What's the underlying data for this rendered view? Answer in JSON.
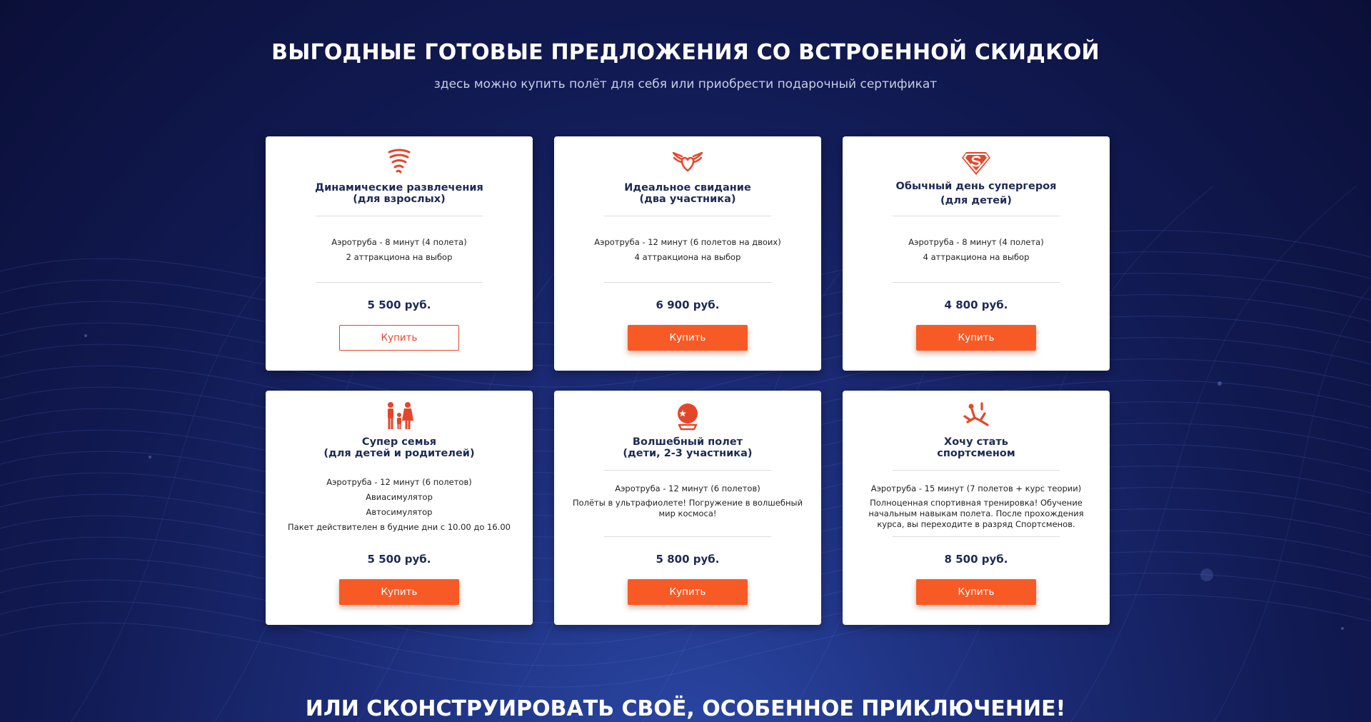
{
  "colors": {
    "accent": "#f85a25",
    "card_title": "#1e2a55",
    "background_dark": "#0b0f38",
    "background_light": "#2c4aa8"
  },
  "header": {
    "title": "ВЫГОДНЫЕ ГОТОВЫЕ ПРЕДЛОЖЕНИЯ СО ВСТРОЕННОЙ СКИДКОЙ",
    "subtitle": "здесь можно купить полёт для себя или приобрести подарочный сертификат"
  },
  "cards": [
    {
      "icon": "tornado-icon",
      "title": "Динамические развлечения\n(для взрослых)",
      "features": [
        "Аэротруба - 8 минут (4 полета)",
        "2 аттракциона на выбор"
      ],
      "price": "5 500 руб.",
      "button_label": "Купить",
      "button_style": "outline"
    },
    {
      "icon": "winged-heart-icon",
      "title": "Идеальное свидание\n(два участника)",
      "features": [
        "Аэротруба - 12 минут (6 полетов на двоих)",
        "4 аттракциона на выбор"
      ],
      "price": "6 900 руб.",
      "button_label": "Купить",
      "button_style": "filled"
    },
    {
      "icon": "superhero-shield-icon",
      "title": "Обычный день супергероя\n(для детей)",
      "features": [
        "Аэротруба - 8 минут (4 полета)",
        "4 аттракциона на выбор"
      ],
      "price": "4 800 руб.",
      "button_label": "Купить",
      "button_style": "filled"
    },
    {
      "icon": "family-icon",
      "title": "Супер семья\n(для детей и родителей)",
      "features": [
        "Аэротруба - 12 минут (6 полетов)",
        "Авиасимулятор",
        "Автосимулятор",
        "Пакет действителен в будние дни с 10.00 до 16.00"
      ],
      "price": "5 500 руб.",
      "button_label": "Купить",
      "button_style": "filled"
    },
    {
      "icon": "crystal-ball-icon",
      "title": "Волшебный полет\n(дети, 2-3 участника)",
      "features": [
        "Аэротруба - 12 минут (6 полетов)",
        "Полёты в ультрафиолете! Погружение в волшебный мир космоса!"
      ],
      "price": "5 800 руб.",
      "button_label": "Купить",
      "button_style": "filled"
    },
    {
      "icon": "skydiver-icon",
      "title": "Хочу стать\nспортсменом",
      "features": [
        "Аэротруба - 15 минут (7 полетов + курс теории)",
        "Полноценная спортивная тренировка! Обучение начальным навыкам полета. После прохождения курса, вы переходите в разряд Спортсменов."
      ],
      "price": "8 500 руб.",
      "button_label": "Купить",
      "button_style": "filled"
    }
  ],
  "footer": {
    "title": "ИЛИ СКОНСТРУИРОВАТЬ СВОЁ, ОСОБЕННОЕ ПРИКЛЮЧЕНИЕ!"
  }
}
